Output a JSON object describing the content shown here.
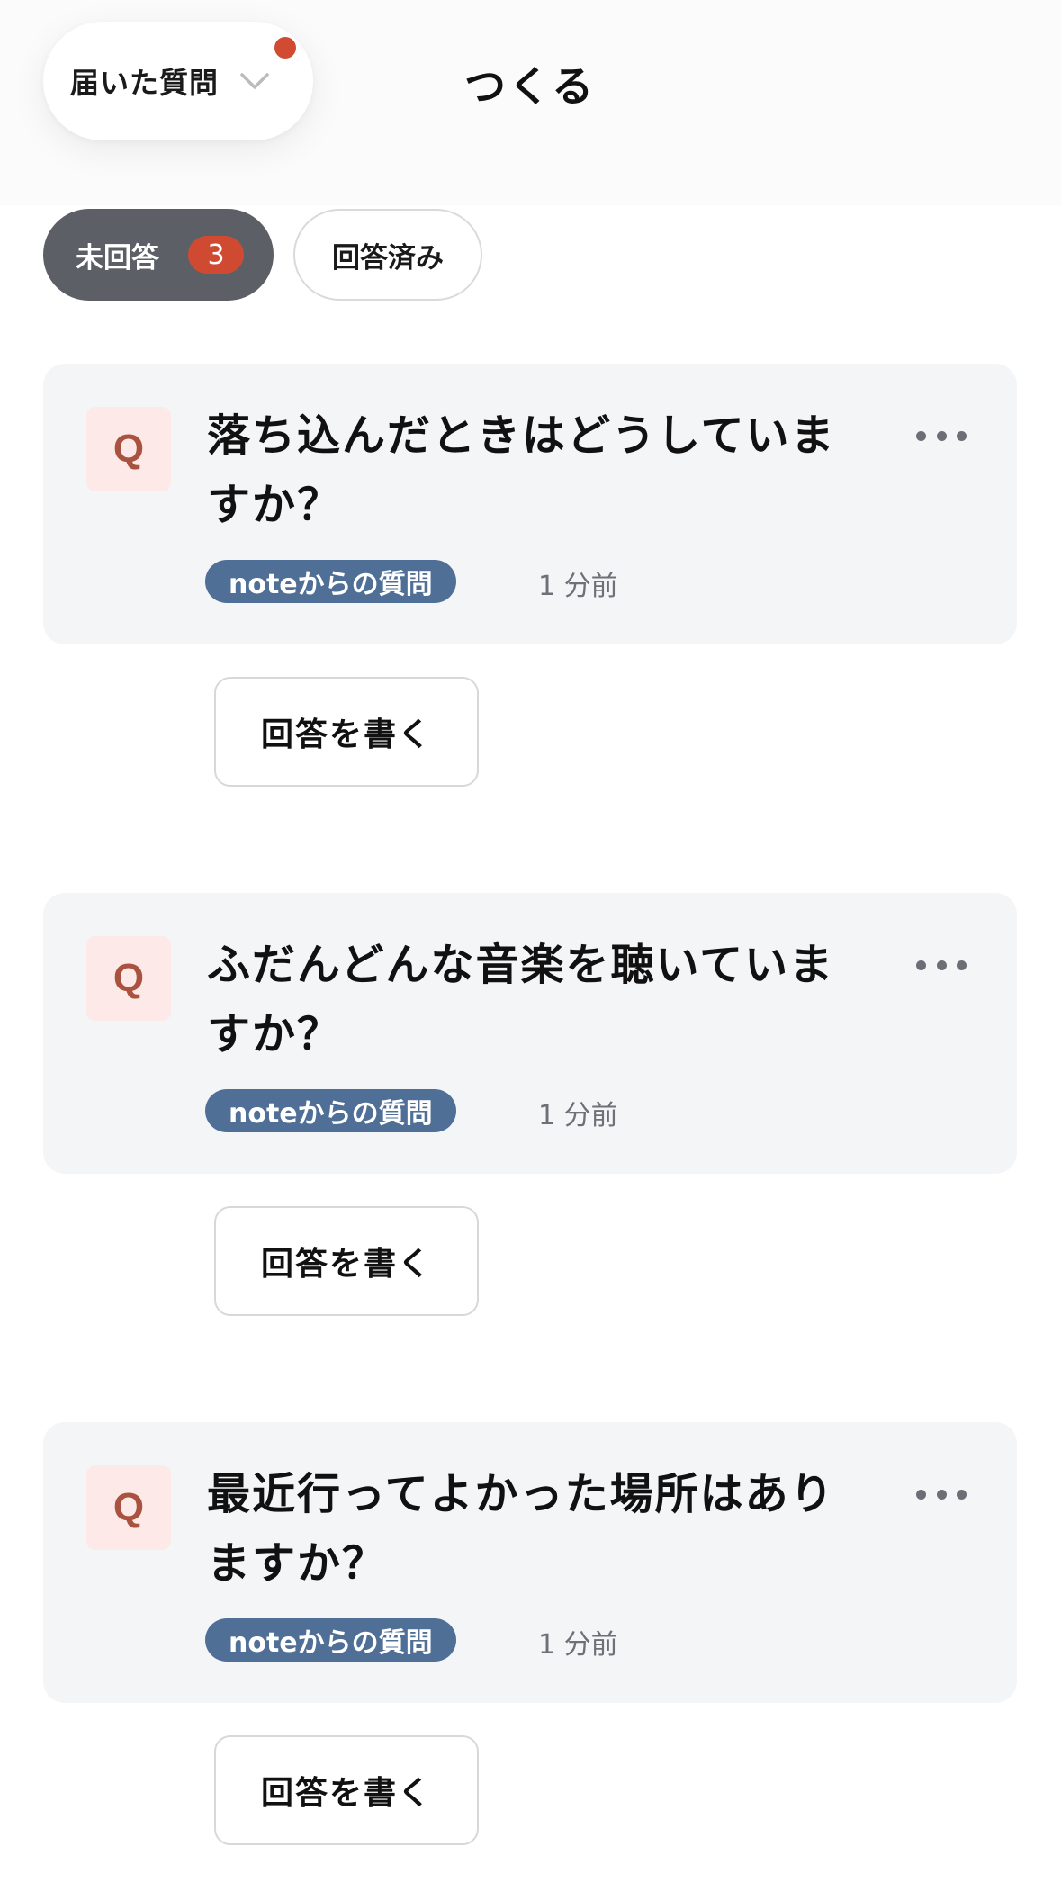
{
  "header": {
    "mode_dropdown_label": "届いた質問",
    "create_tab_label": "つくる",
    "has_notification": true,
    "notification_color": "#d14a32"
  },
  "filters": {
    "unanswered": {
      "label": "未回答",
      "count": "3",
      "selected": true
    },
    "answered": {
      "label": "回答済み",
      "selected": false
    }
  },
  "questions": [
    {
      "icon_letter": "Q",
      "text": "落ち込んだときはどうしていますか？",
      "source": "noteからの質問",
      "time": "1 分前",
      "answer_button": "回答を書く"
    },
    {
      "icon_letter": "Q",
      "text": "ふだんどんな音楽を聴いていますか？",
      "source": "noteからの質問",
      "time": "1 分前",
      "answer_button": "回答を書く"
    },
    {
      "icon_letter": "Q",
      "text": "最近行ってよかった場所はありますか？",
      "source": "noteからの質問",
      "time": "1 分前",
      "answer_button": "回答を書く"
    }
  ],
  "colors": {
    "selected_filter_bg": "#5c6066",
    "badge_red": "#d04a31",
    "source_badge_blue": "#4f6f97",
    "card_bg": "#f4f5f7",
    "q_icon_bg": "#fde9e7",
    "q_icon_text": "#a8523f"
  }
}
